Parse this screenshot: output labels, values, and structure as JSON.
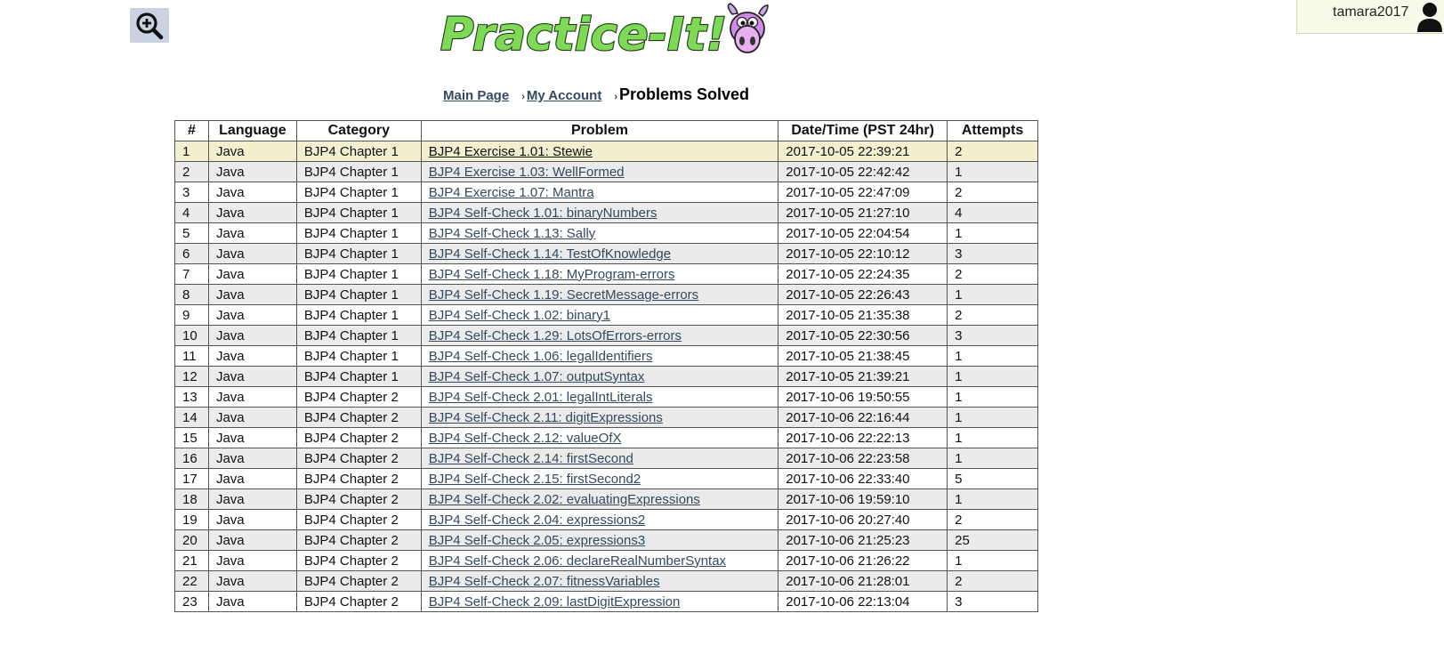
{
  "header": {
    "logo_text": "Practice-It!",
    "username": "tamara2017"
  },
  "icons": {
    "zoom": "zoom-in-icon",
    "user": "user-icon"
  },
  "colors": {
    "link": "#34495e",
    "highlight_row": "#f2f0cf",
    "alt_row": "#ebebeb",
    "logo_green": "#7ed957"
  },
  "breadcrumb": {
    "main": "Main Page",
    "account": "My Account",
    "sep": "›",
    "current": "Problems Solved"
  },
  "table": {
    "headers": [
      "#",
      "Language",
      "Category",
      "Problem",
      "Date/Time (PST 24hr)",
      "Attempts"
    ],
    "rows": [
      [
        "1",
        "Java",
        "BJP4 Chapter 1",
        "BJP4 Exercise 1.01: Stewie",
        "2017-10-05 22:39:21",
        "2"
      ],
      [
        "2",
        "Java",
        "BJP4 Chapter 1",
        "BJP4 Exercise 1.03: WellFormed",
        "2017-10-05 22:42:42",
        "1"
      ],
      [
        "3",
        "Java",
        "BJP4 Chapter 1",
        "BJP4 Exercise 1.07: Mantra",
        "2017-10-05 22:47:09",
        "2"
      ],
      [
        "4",
        "Java",
        "BJP4 Chapter 1",
        "BJP4 Self-Check 1.01: binaryNumbers",
        "2017-10-05 21:27:10",
        "4"
      ],
      [
        "5",
        "Java",
        "BJP4 Chapter 1",
        "BJP4 Self-Check 1.13: Sally",
        "2017-10-05 22:04:54",
        "1"
      ],
      [
        "6",
        "Java",
        "BJP4 Chapter 1",
        "BJP4 Self-Check 1.14: TestOfKnowledge",
        "2017-10-05 22:10:12",
        "3"
      ],
      [
        "7",
        "Java",
        "BJP4 Chapter 1",
        "BJP4 Self-Check 1.18: MyProgram-errors",
        "2017-10-05 22:24:35",
        "2"
      ],
      [
        "8",
        "Java",
        "BJP4 Chapter 1",
        "BJP4 Self-Check 1.19: SecretMessage-errors",
        "2017-10-05 22:26:43",
        "1"
      ],
      [
        "9",
        "Java",
        "BJP4 Chapter 1",
        "BJP4 Self-Check 1.02: binary1",
        "2017-10-05 21:35:38",
        "2"
      ],
      [
        "10",
        "Java",
        "BJP4 Chapter 1",
        "BJP4 Self-Check 1.29: LotsOfErrors-errors",
        "2017-10-05 22:30:56",
        "3"
      ],
      [
        "11",
        "Java",
        "BJP4 Chapter 1",
        "BJP4 Self-Check 1.06: legalIdentifiers",
        "2017-10-05 21:38:45",
        "1"
      ],
      [
        "12",
        "Java",
        "BJP4 Chapter 1",
        "BJP4 Self-Check 1.07: outputSyntax",
        "2017-10-05 21:39:21",
        "1"
      ],
      [
        "13",
        "Java",
        "BJP4 Chapter 2",
        "BJP4 Self-Check 2.01: legalIntLiterals",
        "2017-10-06 19:50:55",
        "1"
      ],
      [
        "14",
        "Java",
        "BJP4 Chapter 2",
        "BJP4 Self-Check 2.11: digitExpressions",
        "2017-10-06 22:16:44",
        "1"
      ],
      [
        "15",
        "Java",
        "BJP4 Chapter 2",
        "BJP4 Self-Check 2.12: valueOfX",
        "2017-10-06 22:22:13",
        "1"
      ],
      [
        "16",
        "Java",
        "BJP4 Chapter 2",
        "BJP4 Self-Check 2.14: firstSecond",
        "2017-10-06 22:23:58",
        "1"
      ],
      [
        "17",
        "Java",
        "BJP4 Chapter 2",
        "BJP4 Self-Check 2.15: firstSecond2",
        "2017-10-06 22:33:40",
        "5"
      ],
      [
        "18",
        "Java",
        "BJP4 Chapter 2",
        "BJP4 Self-Check 2.02: evaluatingExpressions",
        "2017-10-06 19:59:10",
        "1"
      ],
      [
        "19",
        "Java",
        "BJP4 Chapter 2",
        "BJP4 Self-Check 2.04: expressions2",
        "2017-10-06 20:27:40",
        "2"
      ],
      [
        "20",
        "Java",
        "BJP4 Chapter 2",
        "BJP4 Self-Check 2.05: expressions3",
        "2017-10-06 21:25:23",
        "25"
      ],
      [
        "21",
        "Java",
        "BJP4 Chapter 2",
        "BJP4 Self-Check 2.06: declareRealNumberSyntax",
        "2017-10-06 21:26:22",
        "1"
      ],
      [
        "22",
        "Java",
        "BJP4 Chapter 2",
        "BJP4 Self-Check 2.07: fitnessVariables",
        "2017-10-06 21:28:01",
        "2"
      ],
      [
        "23",
        "Java",
        "BJP4 Chapter 2",
        "BJP4 Self-Check 2.09: lastDigitExpression",
        "2017-10-06 22:13:04",
        "3"
      ]
    ]
  }
}
